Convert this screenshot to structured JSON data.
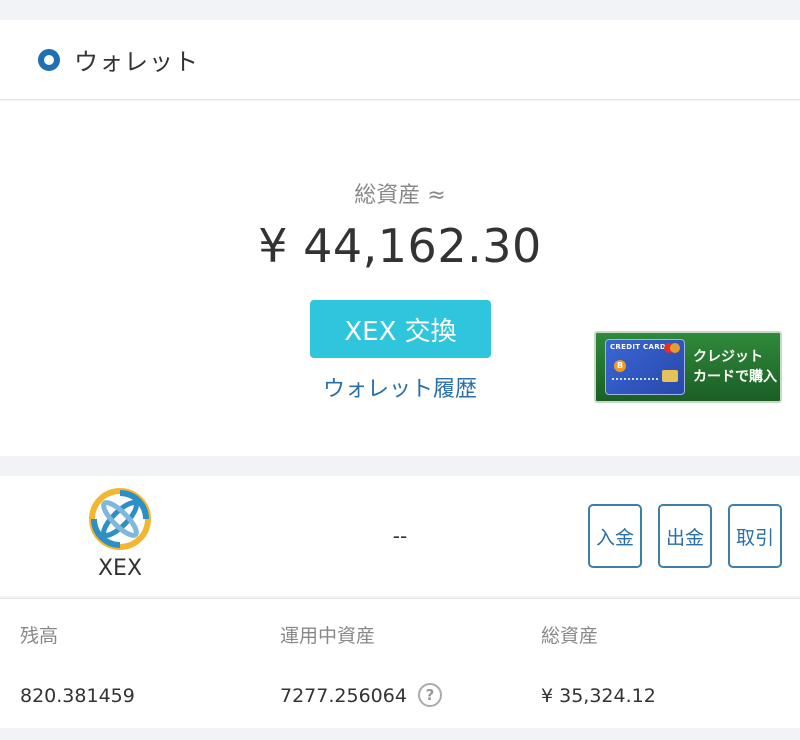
{
  "header": {
    "title": "ウォレット",
    "icon": "wallet-ring-icon"
  },
  "summary": {
    "total_label": "総資産 ≈",
    "total_value": "¥ 44,162.30",
    "exchange_button": "XEX 交換",
    "history_link": "ウォレット履歴"
  },
  "banner": {
    "card_text": "CREDIT CARD",
    "coin_mark": "B",
    "line1": "クレジット",
    "line2": "カードで購入"
  },
  "coin": {
    "name": "XEX",
    "change": "--",
    "buttons": {
      "deposit": "入金",
      "withdraw": "出金",
      "trade": "取引"
    }
  },
  "balances": {
    "labels": [
      "残高",
      "運用中資産",
      "総資産"
    ],
    "values": [
      "820.381459",
      "7277.256064",
      "¥ 35,324.12"
    ],
    "help_icon": "question-icon"
  },
  "colors": {
    "brand_blue": "#1f6fb3",
    "exchange_cyan": "#2fc6dd",
    "banner_green": "#2f8a3a"
  }
}
